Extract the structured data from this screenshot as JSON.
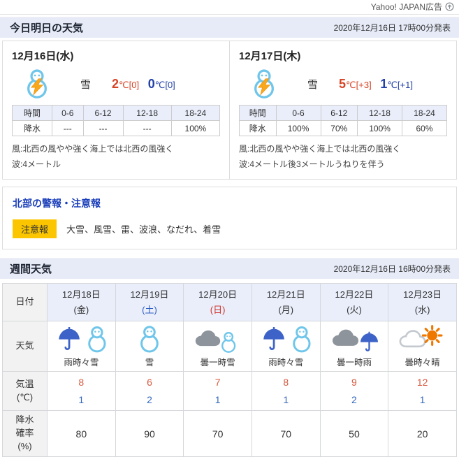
{
  "colors": {
    "header_bg": "#e6ebf7",
    "table_head_bg": "#e9eefa",
    "temp_high": "#d64426",
    "temp_low": "#2341a8",
    "temp_high_wk": "#d85a40",
    "temp_low_wk": "#3567bd",
    "link_blue": "#1b3fba",
    "badge_bg": "#fbc600",
    "sat_blue": "#2a5bc4",
    "sun_red": "#d0342c"
  },
  "ad": {
    "label": "Yahoo! JAPAN広告"
  },
  "today": {
    "title": "今日明日の天気",
    "published": "2020年12月16日 17時00分発表",
    "cards": [
      {
        "date": "12月16日(水)",
        "icon": "snowman-thunder",
        "condition": "雪",
        "high": "2",
        "high_unit": "℃[0]",
        "low": "0",
        "low_unit": "℃[0]",
        "table": {
          "header": [
            "時間",
            "0-6",
            "6-12",
            "12-18",
            "18-24"
          ],
          "row_label": "降水",
          "values": [
            "---",
            "---",
            "---",
            "100%"
          ]
        },
        "wind": "風:北西の風やや強く海上では北西の風強く",
        "wave": "波:4メートル"
      },
      {
        "date": "12月17日(木)",
        "icon": "snowman-thunder",
        "condition": "雪",
        "high": "5",
        "high_unit": "℃[+3]",
        "low": "1",
        "low_unit": "℃[+1]",
        "table": {
          "header": [
            "時間",
            "0-6",
            "6-12",
            "12-18",
            "18-24"
          ],
          "row_label": "降水",
          "values": [
            "100%",
            "70%",
            "100%",
            "60%"
          ]
        },
        "wind": "風:北西の風やや強く海上では北西の風強く",
        "wave": "波:4メートル後3メートルうねりを伴う"
      }
    ]
  },
  "warnings": {
    "title": "北部の警報・注意報",
    "badge": "注意報",
    "items": "大雪、風雪、雷、波浪、なだれ、着雪"
  },
  "weekly": {
    "title": "週間天気",
    "published": "2020年12月16日 16時00分発表",
    "labels": {
      "date": "日付",
      "weather": "天気",
      "temp_l1": "気温",
      "temp_l2": "(℃)",
      "precip_l1": "降水",
      "precip_l2": "確率",
      "precip_l3": "(%)"
    },
    "days": [
      {
        "date": "12月18日",
        "weekday": "(金)",
        "icon": "umbrella-snowman",
        "condition": "雨時々雪",
        "high": "8",
        "low": "1",
        "precip": "80"
      },
      {
        "date": "12月19日",
        "weekday": "(土)",
        "icon": "snowman",
        "condition": "雪",
        "high": "6",
        "low": "2",
        "precip": "90"
      },
      {
        "date": "12月20日",
        "weekday": "(日)",
        "icon": "cloud-snowman",
        "condition": "曇一時雪",
        "high": "7",
        "low": "1",
        "precip": "70"
      },
      {
        "date": "12月21日",
        "weekday": "(月)",
        "icon": "umbrella-snowman",
        "condition": "雨時々雪",
        "high": "8",
        "low": "1",
        "precip": "70"
      },
      {
        "date": "12月22日",
        "weekday": "(火)",
        "icon": "cloud-umbrella",
        "condition": "曇一時雨",
        "high": "9",
        "low": "2",
        "precip": "50"
      },
      {
        "date": "12月23日",
        "weekday": "(水)",
        "icon": "cloud-sun",
        "condition": "曇時々晴",
        "high": "12",
        "low": "1",
        "precip": "20"
      }
    ]
  }
}
